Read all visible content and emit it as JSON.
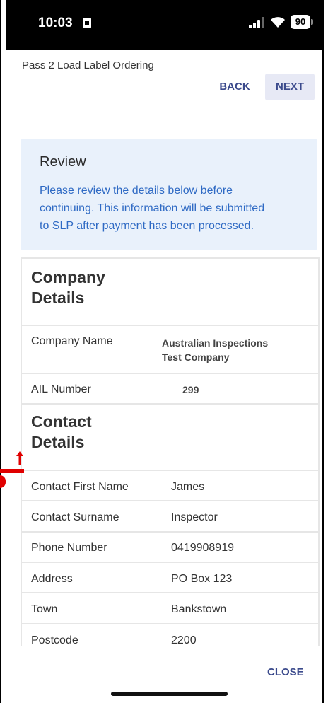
{
  "status_bar": {
    "time": "10:03",
    "battery": "90"
  },
  "header": {
    "title": "Pass 2 Load Label Ordering",
    "back_label": "BACK",
    "next_label": "NEXT"
  },
  "review": {
    "title": "Review",
    "lines": [
      "Please review the details below before",
      "continuing. This information will be submitted",
      "to SLP after payment has been processed."
    ]
  },
  "company": {
    "section_line1": "Company",
    "section_line2": "Details",
    "rows": [
      {
        "label": "Company Name",
        "value_line1": "Australian Inspections",
        "value_line2": "Test Company"
      },
      {
        "label": "AIL Number",
        "value_line1": "299"
      }
    ]
  },
  "contact": {
    "section_line1": "Contact",
    "section_line2": "Details",
    "rows": [
      {
        "label": "Contact First Name",
        "value": "James"
      },
      {
        "label": "Contact Surname",
        "value": "Inspector"
      },
      {
        "label": "Phone Number",
        "value": "0419908919"
      },
      {
        "label": "Address",
        "value": "PO Box 123"
      },
      {
        "label": "Town",
        "value": "Bankstown"
      },
      {
        "label": "Postcode",
        "value": "2200"
      }
    ]
  },
  "footer": {
    "close_label": "CLOSE"
  },
  "colors": {
    "accent": "#3b4a8c",
    "review_bg": "#e9f1fb",
    "review_text": "#2f6ac4",
    "marker": "#e00000"
  }
}
